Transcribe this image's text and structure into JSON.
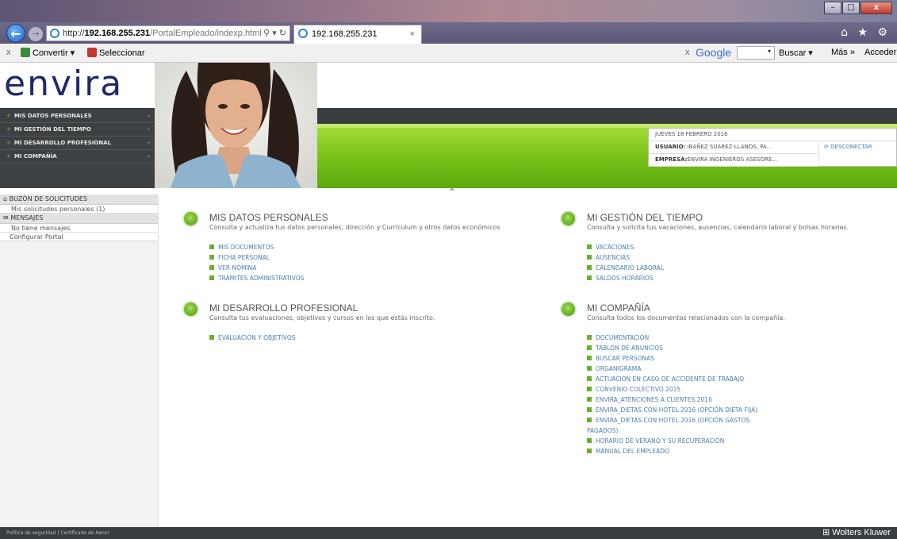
{
  "browser": {
    "address": {
      "prefix": "http://",
      "domain": "192.168.255.231",
      "path": "/PortalEmpleado/indexp.html",
      "tools": "⚲ ▾ ↻"
    },
    "tab_title": "192.168.255.231",
    "tab_close": "×",
    "back": "←",
    "forward": "→",
    "window_buttons": {
      "minimize": "–",
      "maximize": "□",
      "close": "x"
    },
    "chrome_icons": "⌂ ★ ⚙"
  },
  "toolbar": {
    "close": "x",
    "convert": "Convertir ▾",
    "select": "Seleccionar",
    "google_close": "x",
    "google": "Google",
    "google_drop": "▾",
    "buscar": "Buscar ▾",
    "mas": "Más »",
    "acceder": "Acceder"
  },
  "header": {
    "logo": "envira",
    "toggle": "⌃"
  },
  "menu": [
    {
      "label": "MIS DATOS PERSONALES"
    },
    {
      "label": "MI GESTIÓN DEL TIEMPO"
    },
    {
      "label": "MI DESARROLLO PROFESIONAL"
    },
    {
      "label": "MI COMPAÑÍA"
    }
  ],
  "menu_star": "✧",
  "menu_arrow": "›",
  "info": {
    "date": "JUEVES 18 FEBRERO 2016",
    "user_label": "USUARIO:",
    "user_value": " IBAÑEZ SUAREZ-LLANOS, PA...",
    "company_label": "EMPRESA:",
    "company_value": "ENVIRA INGENIEROS ASESORE...",
    "disconnect": "⟳ DESCONECTAR"
  },
  "sidebar": {
    "buzon": "⌂ BUZÓN DE SOLICITUDES",
    "solicitudes": "Mis solicitudes personales (1)",
    "mensajes": "✉ MENSAJES",
    "no_mensajes": "No tiene mensajes",
    "configurar": "Configurar Portal"
  },
  "sections": {
    "datos": {
      "title": "MIS DATOS PERSONALES",
      "desc": "Consulta y actualiza tus datos personales, dirección y Currículum y otros datos económicos",
      "links": [
        "MIS DOCUMENTOS",
        "FICHA PERSONAL",
        "VER NÓMINA",
        "TRÁMITES ADMINISTRATIVOS"
      ]
    },
    "tiempo": {
      "title": "MI GESTIÓN DEL TIEMPO",
      "desc": "Consulta y solicita tus vacaciones, ausencias, calendario laboral y bolsas horarias.",
      "links": [
        "VACACIONES",
        "AUSENCIAS",
        "CALENDARIO LABORAL",
        "SALDOS HORARIOS"
      ]
    },
    "desarrollo": {
      "title": "MI DESARROLLO PROFESIONAL",
      "desc": "Consulta tus evaluaciones, objetivos y cursos en los que estás inscrito.",
      "links": [
        "EVALUACIÓN Y OBJETIVOS"
      ]
    },
    "compania": {
      "title": "MI COMPAÑÍA",
      "desc": "Consulta todos los documentos relacionados con la compañía.",
      "links": [
        "DOCUMENTACIÓN",
        "TABLÓN DE ANUNCIOS",
        "BUSCAR PERSONAS",
        "ORGANIGRAMA",
        "ACTUACIÓN EN CASO DE ACCIDENTE DE TRABAJO",
        "CONVENIO COLECTIVO 2015",
        "ENVIRA_ATENCIONES A CLIENTES 2016",
        "ENVIRA_DIETAS CON HOTEL 2016 (OPCIÓN DIETA FIJA)",
        "ENVIRA_DIETAS CON HOTEL 2016 (OPCIÓN GASTOS PAGADOS)",
        "HORARIO DE VERANO Y SU RECUPERACIÓN",
        "MANUAL DEL EMPLEADO"
      ]
    }
  },
  "section_icon": "⁘",
  "footer": {
    "links": "Política de seguridad  |  Certificado de Aenor",
    "brand": "⊞ Wolters Kluwer"
  },
  "colors": {
    "accent_green": "#7cc61c",
    "dark_bar": "#3a3d3f",
    "link_blue": "#4a7fb0",
    "logo_navy": "#22286e"
  }
}
